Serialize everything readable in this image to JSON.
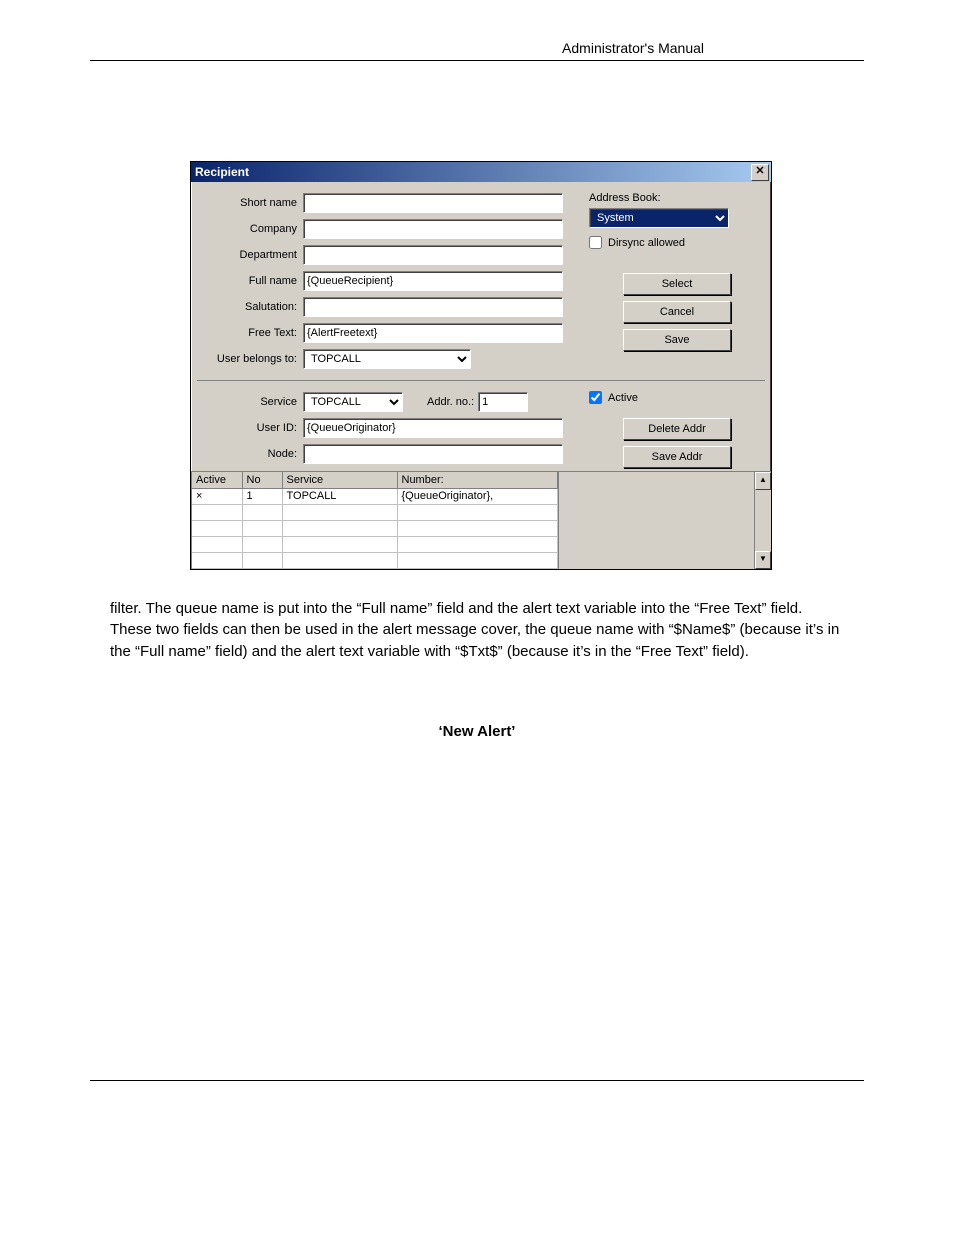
{
  "doc": {
    "header": "Administrator's Manual",
    "paragraph": "filter. The queue name is put into the “Full name” field and the alert text variable into the “Free Text” field. These two fields can then be used in the alert message cover, the queue name with “$Name$” (because it’s in the “Full name” field) and the alert text variable with “$Txt$” (because it’s in the “Free Text” field).",
    "heading": "‘New Alert’"
  },
  "dialog": {
    "title": "Recipient",
    "labels": {
      "short_name": "Short name",
      "company": "Company",
      "department": "Department",
      "full_name": "Full name",
      "salutation": "Salutation:",
      "free_text": "Free Text:",
      "user_belongs_to": "User belongs to:",
      "address_book": "Address Book:",
      "dirsync_allowed": "Dirsync allowed",
      "service": "Service",
      "addr_no": "Addr. no.:",
      "active": "Active",
      "user_id": "User ID:",
      "node": "Node:"
    },
    "values": {
      "short_name": "",
      "company": "",
      "department": "",
      "full_name": "{QueueRecipient}",
      "salutation": "",
      "free_text": "{AlertFreetext}",
      "user_belongs_to": "TOPCALL",
      "address_book": "System",
      "dirsync_allowed": false,
      "service": "TOPCALL",
      "addr_no": "1",
      "active": true,
      "user_id": "{QueueOriginator}",
      "node": ""
    },
    "buttons": {
      "select": "Select",
      "cancel": "Cancel",
      "save": "Save",
      "delete_addr": "Delete Addr",
      "save_addr": "Save Addr"
    },
    "table": {
      "columns": {
        "active": "Active",
        "no": "No",
        "service": "Service",
        "number": "Number:"
      },
      "rows": [
        {
          "active": "×",
          "no": "1",
          "service": "TOPCALL",
          "number": "{QueueOriginator},"
        }
      ],
      "blank_rows": 4
    }
  }
}
